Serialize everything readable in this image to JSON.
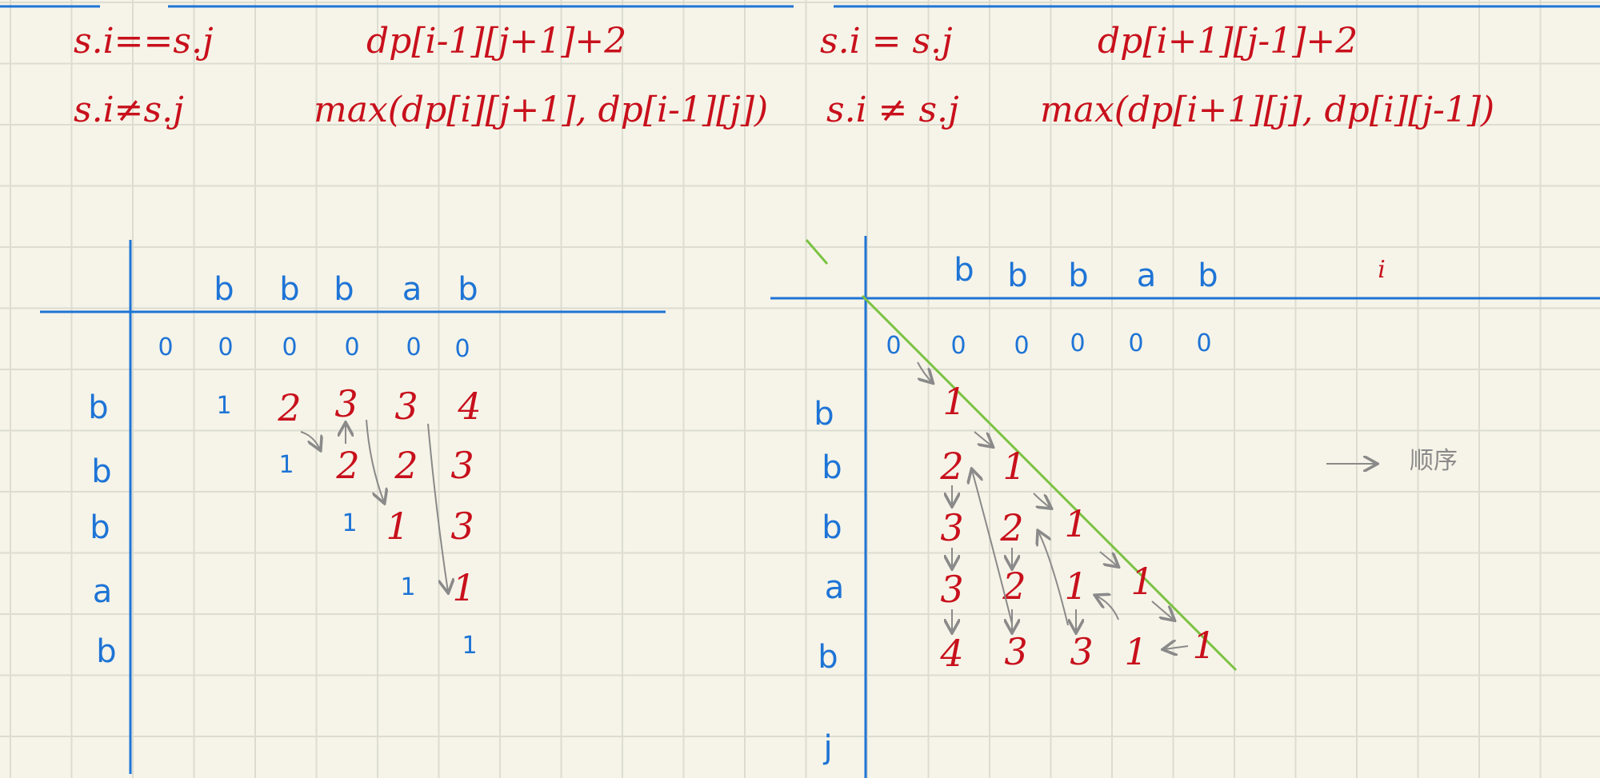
{
  "formulas": {
    "left": {
      "eq_cond": "s.i==s.j",
      "eq_expr": "dp[i-1][j+1]+2",
      "neq_cond": "s.i≠s.j",
      "neq_expr": "max(dp[i][j+1], dp[i-1][j])"
    },
    "right": {
      "eq_cond": "s.i = s.j",
      "eq_expr": "dp[i+1][j-1]+2",
      "neq_cond": "s.i ≠ s.j",
      "neq_expr": "max(dp[i+1][j], dp[i][j-1])"
    }
  },
  "left_table": {
    "col_headers": [
      "b",
      "b",
      "b",
      "a",
      "b"
    ],
    "row_headers": [
      "b",
      "b",
      "b",
      "a",
      "b"
    ],
    "zero_row": [
      "0",
      "0",
      "0",
      "0",
      "0",
      "0"
    ],
    "rows": [
      [
        "1",
        "2",
        "3",
        "3",
        "4"
      ],
      [
        "1",
        "2",
        "2",
        "3"
      ],
      [
        "1",
        "1",
        "3"
      ],
      [
        "1",
        "1"
      ],
      [
        "1"
      ]
    ]
  },
  "right_table": {
    "col_headers": [
      "b",
      "b",
      "b",
      "a",
      "b"
    ],
    "axis_i": "i",
    "axis_j": "j",
    "row_headers": [
      "b",
      "b",
      "b",
      "a",
      "b"
    ],
    "zero_row": [
      "0",
      "0",
      "0",
      "0",
      "0",
      "0"
    ],
    "rows": [
      [
        "1"
      ],
      [
        "2",
        "1"
      ],
      [
        "3",
        "2",
        "1"
      ],
      [
        "3",
        "2",
        "1",
        "1"
      ],
      [
        "4",
        "3",
        "3",
        "1",
        "1"
      ]
    ]
  },
  "note": {
    "text": "顺序"
  },
  "colors": {
    "paper": "#f6f4e8",
    "grid": "#dcdcd0",
    "ink_red": "#c8101c",
    "ink_blue": "#1e74d6",
    "ink_gray": "#8a8a8a",
    "ink_green": "#7cc242"
  }
}
